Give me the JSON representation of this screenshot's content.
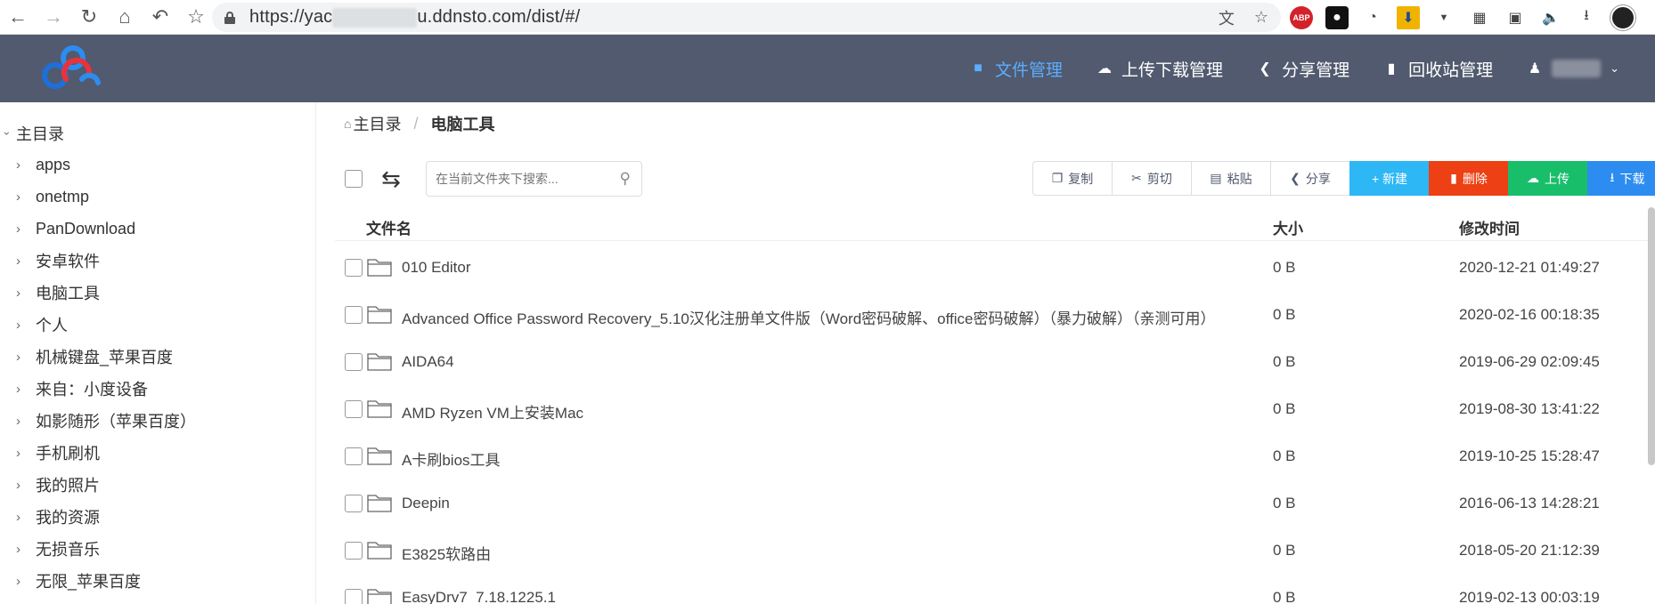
{
  "browser": {
    "url_prefix": "https://yac",
    "url_suffix": "u.ddnsto.com/dist/#/"
  },
  "header": {
    "nav": [
      {
        "label": "文件管理",
        "icon": "folder-icon",
        "active": true
      },
      {
        "label": "上传下载管理",
        "icon": "cloud-icon"
      },
      {
        "label": "分享管理",
        "icon": "share-icon"
      },
      {
        "label": "回收站管理",
        "icon": "trash-icon"
      }
    ]
  },
  "sidebar": {
    "root": "主目录",
    "items": [
      {
        "label": "apps"
      },
      {
        "label": "onetmp"
      },
      {
        "label": "PanDownload"
      },
      {
        "label": "安卓软件"
      },
      {
        "label": "电脑工具"
      },
      {
        "label": "个人"
      },
      {
        "label": "机械键盘_苹果百度"
      },
      {
        "label": "来自：小度设备"
      },
      {
        "label": "如影随形（苹果百度）"
      },
      {
        "label": "手机刷机"
      },
      {
        "label": "我的照片"
      },
      {
        "label": "我的资源"
      },
      {
        "label": "无损音乐"
      },
      {
        "label": "无限_苹果百度"
      }
    ]
  },
  "breadcrumb": {
    "home": "主目录",
    "separator": "/",
    "current": "电脑工具"
  },
  "search": {
    "placeholder": "在当前文件夹下搜索..."
  },
  "toolbar": {
    "copy": "复制",
    "cut": "剪切",
    "paste": "粘贴",
    "share": "分享",
    "create": "+ 新建",
    "delete": "删除",
    "upload": "上传",
    "download": "下载"
  },
  "table": {
    "columns": {
      "name": "文件名",
      "size": "大小",
      "mtime": "修改时间"
    },
    "rows": [
      {
        "name": "010 Editor",
        "size": "0 B",
        "mtime": "2020-12-21 01:49:27"
      },
      {
        "name": "Advanced Office Password Recovery_5.10汉化注册单文件版（Word密码破解、office密码破解）（暴力破解）（亲测可用）",
        "size": "0 B",
        "mtime": "2020-02-16 00:18:35"
      },
      {
        "name": "AIDA64",
        "size": "0 B",
        "mtime": "2019-06-29 02:09:45"
      },
      {
        "name": "AMD Ryzen VM上安装Mac",
        "size": "0 B",
        "mtime": "2019-08-30 13:41:22"
      },
      {
        "name": "A卡刷bios工具",
        "size": "0 B",
        "mtime": "2019-10-25 15:28:47"
      },
      {
        "name": "Deepin",
        "size": "0 B",
        "mtime": "2016-06-13 14:28:21"
      },
      {
        "name": "E3825软路由",
        "size": "0 B",
        "mtime": "2018-05-20 21:12:39"
      },
      {
        "name": "EasyDrv7_7.18.1225.1",
        "size": "0 B",
        "mtime": "2019-02-13 00:03:19"
      }
    ]
  }
}
